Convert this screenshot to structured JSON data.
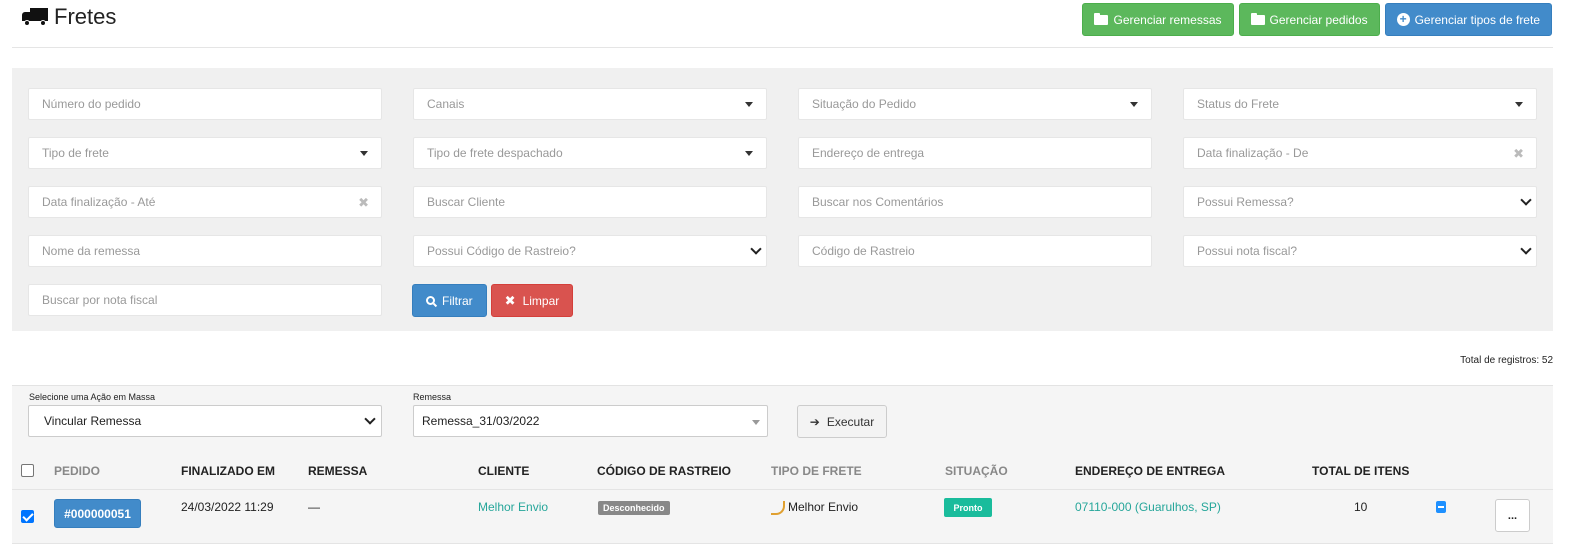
{
  "header": {
    "title": "Fretes",
    "actions": [
      {
        "label": "Gerenciar remessas"
      },
      {
        "label": "Gerenciar pedidos"
      },
      {
        "label": "Gerenciar tipos de frete"
      }
    ]
  },
  "filters": {
    "order_number": "Número do pedido",
    "channels": "Canais",
    "order_status": "Situação do Pedido",
    "freight_status": "Status do Frete",
    "freight_type": "Tipo de frete",
    "dispatched_freight_type": "Tipo de frete despachado",
    "delivery_address": "Endereço de entrega",
    "date_from": "Data finalização - De",
    "date_to": "Data finalização - Até",
    "search_customer": "Buscar Cliente",
    "search_comments": "Buscar nos Comentários",
    "has_shipment": "Possui Remessa?",
    "shipment_name": "Nome da remessa",
    "has_tracking": "Possui Código de Rastreio?",
    "tracking_code": "Código de Rastreio",
    "has_invoice": "Possui nota fiscal?",
    "search_invoice": "Buscar por nota fiscal",
    "filter_button": "Filtrar",
    "clear_button": "Limpar",
    "clear_glyph": "✖"
  },
  "total_records": "Total de registros: 52",
  "bulk": {
    "action_label": "Selecione uma Ação em Massa",
    "action_value": "Vincular Remessa",
    "shipment_label": "Remessa",
    "shipment_value": "Remessa_31/03/2022",
    "execute_button": "Executar",
    "arrow_glyph": "➔"
  },
  "table": {
    "columns": {
      "order": "PEDIDO",
      "finished_at": "FINALIZADO EM",
      "shipment": "REMESSA",
      "customer": "CLIENTE",
      "tracking": "CÓDIGO DE RASTREIO",
      "freight_type": "TIPO DE FRETE",
      "status": "SITUAÇÃO",
      "address": "ENDEREÇO DE ENTREGA",
      "total_items": "TOTAL DE ITENS"
    },
    "rows": [
      {
        "checked": true,
        "order": "#000000051",
        "finished_at": "24/03/2022 11:29",
        "shipment": "—",
        "customer": "Melhor Envio",
        "tracking": "Desconhecido",
        "freight_type": "Melhor Envio",
        "status": "Pronto",
        "address": "07110-000 (Guarulhos, SP)",
        "total_items": "10",
        "more": "..."
      }
    ]
  },
  "colors": {
    "green": "#5cb85c",
    "blue": "#428bca",
    "red": "#d9534f",
    "teal": "#1abc9c",
    "link_green": "#26a69a"
  }
}
